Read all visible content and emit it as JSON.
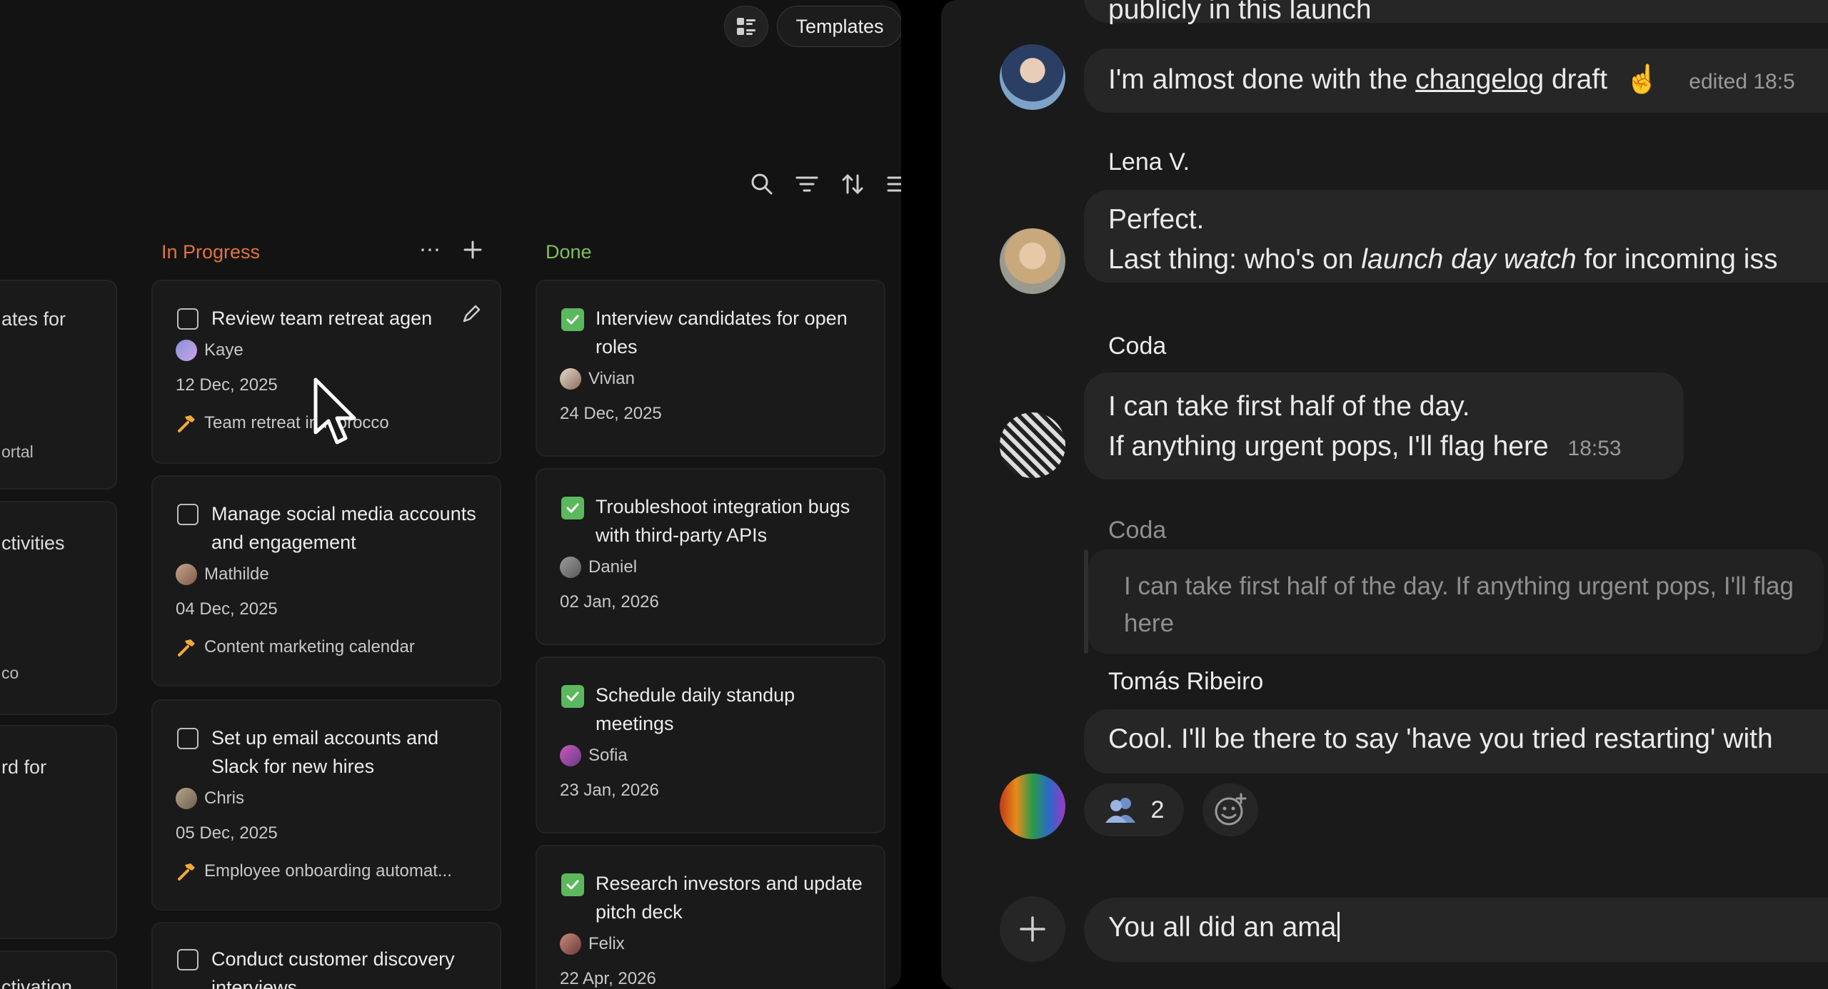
{
  "toolbar": {
    "templates_label": "Templates"
  },
  "columns": {
    "in_progress": {
      "title": "In Progress"
    },
    "done": {
      "title": "Done"
    }
  },
  "partial_column": {
    "items": [
      "ates for",
      "ortal",
      "ctivities",
      "co",
      "rd for",
      "ctivation"
    ]
  },
  "in_progress_cards": [
    {
      "title": "Review team retreat agen",
      "assignee": "Kaye",
      "date": "12 Dec, 2025",
      "project": "Team retreat in Morocco"
    },
    {
      "title": "Manage social media accounts and engagement",
      "assignee": "Mathilde",
      "date": "04 Dec, 2025",
      "project": "Content marketing calendar"
    },
    {
      "title": "Set up email accounts and Slack for new hires",
      "assignee": "Chris",
      "date": "05 Dec, 2025",
      "project": "Employee onboarding automat..."
    },
    {
      "title": "Conduct customer discovery interviews"
    }
  ],
  "done_cards": [
    {
      "title": "Interview candidates for open roles",
      "assignee": "Vivian",
      "date": "24 Dec, 2025"
    },
    {
      "title": "Troubleshoot integration bugs with third-party APIs",
      "assignee": "Daniel",
      "date": "02 Jan, 2026"
    },
    {
      "title": "Schedule daily standup meetings",
      "assignee": "Sofia",
      "date": "23 Jan, 2026"
    },
    {
      "title": "Research investors and update pitch deck",
      "assignee": "Felix",
      "date": "22 Apr, 2026"
    }
  ],
  "chat": {
    "top_partial": "publicly in this launch",
    "msg1": {
      "before": "I'm almost done with the ",
      "link": "changelog",
      "after": " draft",
      "emoji": "☝",
      "edited": "edited 18:5"
    },
    "lena": {
      "name": "Lena V.",
      "line1": "Perfect.",
      "line2_before": "Last thing: who's on ",
      "line2_italic": "launch day watch",
      "line2_after": " for incoming iss"
    },
    "coda": {
      "name": "Coda",
      "line1": "I can take first half of the day.",
      "line2": "If anything urgent pops, I'll flag here",
      "time": "18:53"
    },
    "quote": {
      "name": "Coda",
      "text": "I can take first half of the day. If anything urgent pops, I'll flag here"
    },
    "tomas": {
      "name": "Tomás Ribeiro",
      "text": "Cool. I'll be there to say 'have you tried restarting' with"
    },
    "reaction": {
      "count": "2"
    },
    "composer": {
      "value": "You all did an ama"
    }
  },
  "colors": {
    "in_progress": "#e0733e",
    "done": "#7cc05a",
    "check": "#5cb85c"
  }
}
